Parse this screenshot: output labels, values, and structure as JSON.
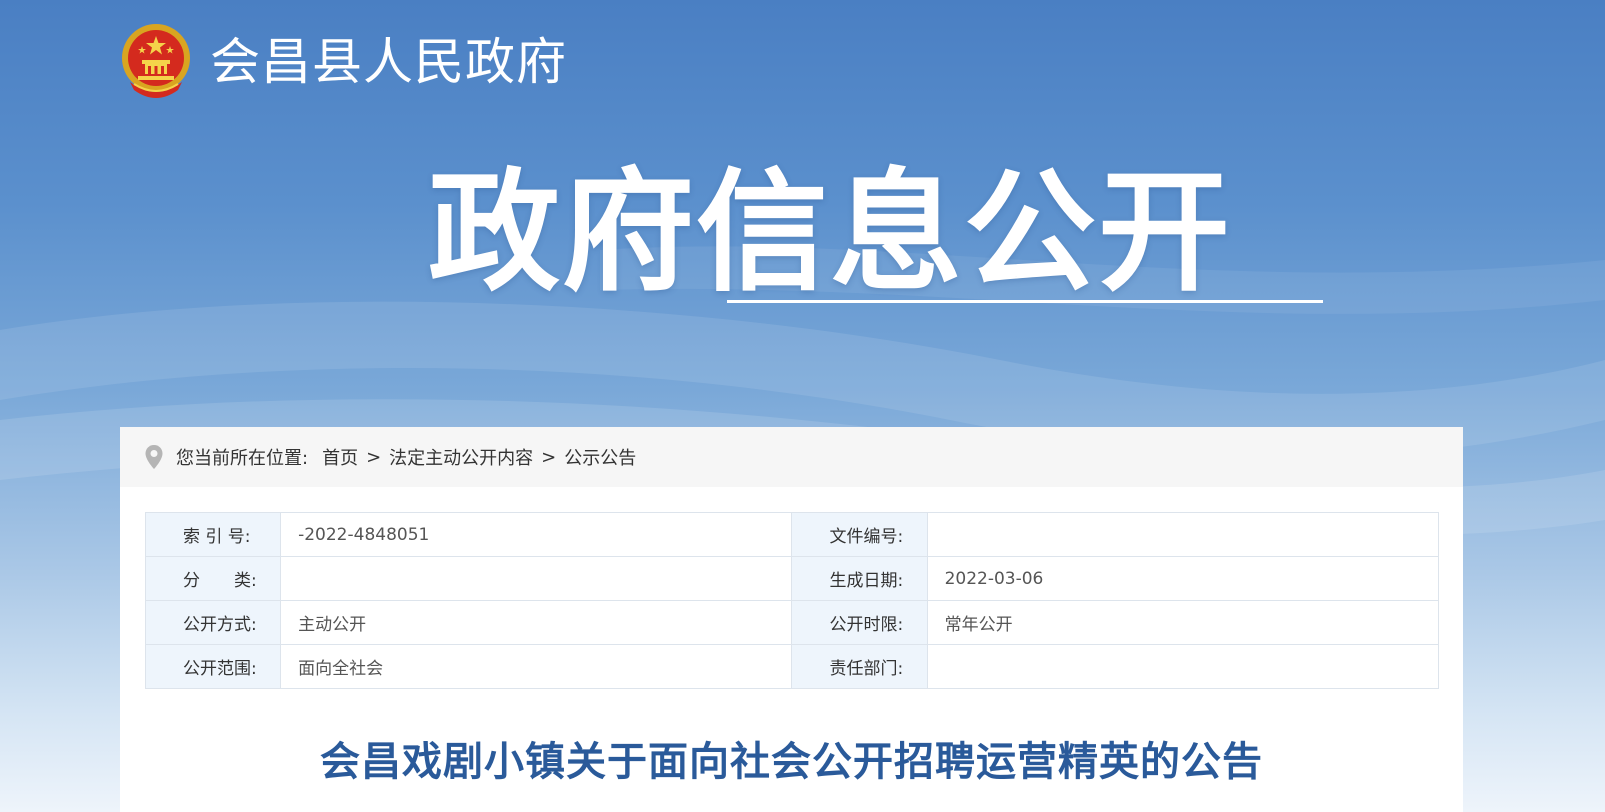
{
  "header": {
    "site_title": "会昌县人民政府",
    "emblem_icon": "national-emblem-icon"
  },
  "banner": {
    "title": "政府信息公开"
  },
  "breadcrumb": {
    "prefix": "您当前所在位置:",
    "items": [
      "首页",
      "法定主动公开内容",
      "公示公告"
    ],
    "separator": ">",
    "icon": "location-pin-icon"
  },
  "meta": {
    "index_label": "索 引 号:",
    "index_value": "-2022-4848051",
    "doc_no_label": "文件编号:",
    "doc_no_value": "",
    "category_label": "分　　类:",
    "category_value": "",
    "date_label": "生成日期:",
    "date_value": "2022-03-06",
    "method_label": "公开方式:",
    "method_value": "主动公开",
    "period_label": "公开时限:",
    "period_value": "常年公开",
    "scope_label": "公开范围:",
    "scope_value": "面向全社会",
    "dept_label": "责任部门:",
    "dept_value": ""
  },
  "article": {
    "title": "会昌戏剧小镇关于面向社会公开招聘运营精英的公告"
  },
  "colors": {
    "title_blue": "#2a5a9a",
    "label_bg": "#eef5fc"
  }
}
